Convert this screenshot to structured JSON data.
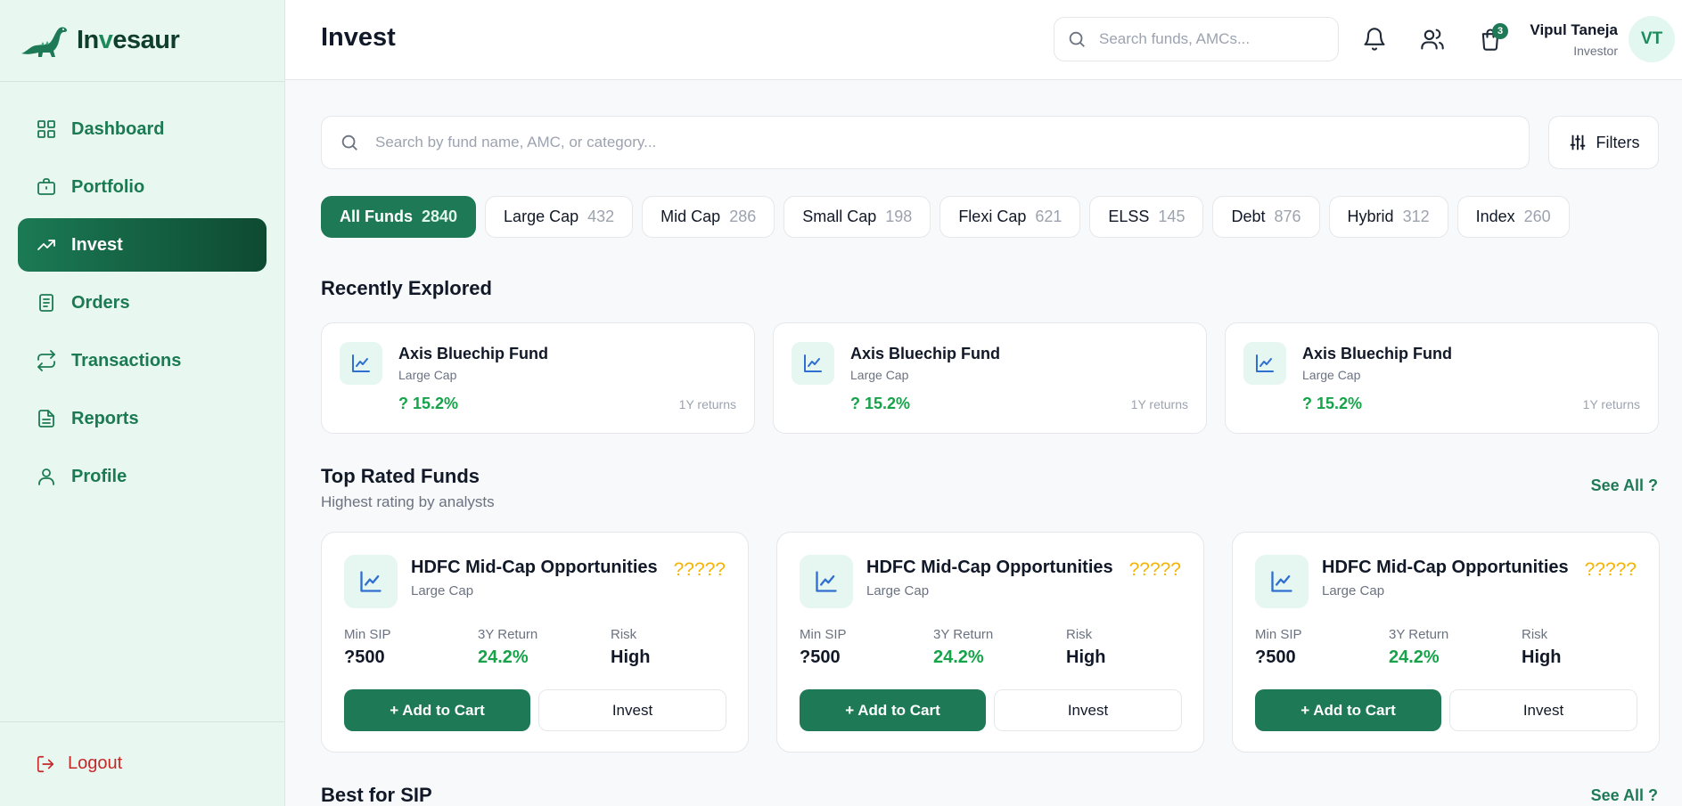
{
  "brand": {
    "name_prefix": "In",
    "name_v": "v",
    "name_suffix": "esaur"
  },
  "sidebar": {
    "items": [
      {
        "label": "Dashboard",
        "icon": "grid-icon"
      },
      {
        "label": "Portfolio",
        "icon": "briefcase-icon"
      },
      {
        "label": "Invest",
        "icon": "trending-up-icon",
        "active": true
      },
      {
        "label": "Orders",
        "icon": "receipt-icon"
      },
      {
        "label": "Transactions",
        "icon": "arrows-cycle-icon"
      },
      {
        "label": "Reports",
        "icon": "document-icon"
      },
      {
        "label": "Profile",
        "icon": "user-icon"
      }
    ],
    "logout_label": "Logout"
  },
  "header": {
    "title": "Invest",
    "search_placeholder": "Search funds, AMCs...",
    "cart_count": "3",
    "user_name": "Vipul Taneja",
    "user_role": "Investor",
    "avatar_initials": "VT"
  },
  "main": {
    "search_placeholder": "Search by fund name, AMC, or category...",
    "filters_label": "Filters",
    "chips": [
      {
        "label": "All Funds",
        "count": "2840",
        "active": true
      },
      {
        "label": "Large Cap",
        "count": "432"
      },
      {
        "label": "Mid Cap",
        "count": "286"
      },
      {
        "label": "Small Cap",
        "count": "198"
      },
      {
        "label": "Flexi Cap",
        "count": "621"
      },
      {
        "label": "ELSS",
        "count": "145"
      },
      {
        "label": "Debt",
        "count": "876"
      },
      {
        "label": "Hybrid",
        "count": "312"
      },
      {
        "label": "Index",
        "count": "260"
      }
    ],
    "recent": {
      "title": "Recently Explored",
      "cards": [
        {
          "name": "Axis Bluechip Fund",
          "category": "Large Cap",
          "returns": "? 15.2%",
          "returns_label": "1Y returns"
        },
        {
          "name": "Axis Bluechip Fund",
          "category": "Large Cap",
          "returns": "? 15.2%",
          "returns_label": "1Y returns"
        },
        {
          "name": "Axis Bluechip Fund",
          "category": "Large Cap",
          "returns": "? 15.2%",
          "returns_label": "1Y returns"
        }
      ]
    },
    "top_rated": {
      "title": "Top Rated Funds",
      "subtitle": "Highest rating by analysts",
      "see_all": "See All ?",
      "cards": [
        {
          "name": "HDFC Mid-Cap Opportunities",
          "category": "Large Cap",
          "stars": "?????",
          "min_sip_label": "Min SIP",
          "min_sip": "?500",
          "return_label": "3Y Return",
          "return": "24.2%",
          "risk_label": "Risk",
          "risk": "High",
          "add_label": "+ Add to Cart",
          "invest_label": "Invest"
        },
        {
          "name": "HDFC Mid-Cap Opportunities",
          "category": "Large Cap",
          "stars": "?????",
          "min_sip_label": "Min SIP",
          "min_sip": "?500",
          "return_label": "3Y Return",
          "return": "24.2%",
          "risk_label": "Risk",
          "risk": "High",
          "add_label": "+ Add to Cart",
          "invest_label": "Invest"
        },
        {
          "name": "HDFC Mid-Cap Opportunities",
          "category": "Large Cap",
          "stars": "?????",
          "min_sip_label": "Min SIP",
          "min_sip": "?500",
          "return_label": "3Y Return",
          "return": "24.2%",
          "risk_label": "Risk",
          "risk": "High",
          "add_label": "+ Add to Cart",
          "invest_label": "Invest"
        }
      ]
    },
    "best_sip": {
      "title": "Best for SIP",
      "see_all": "See All ?"
    }
  }
}
